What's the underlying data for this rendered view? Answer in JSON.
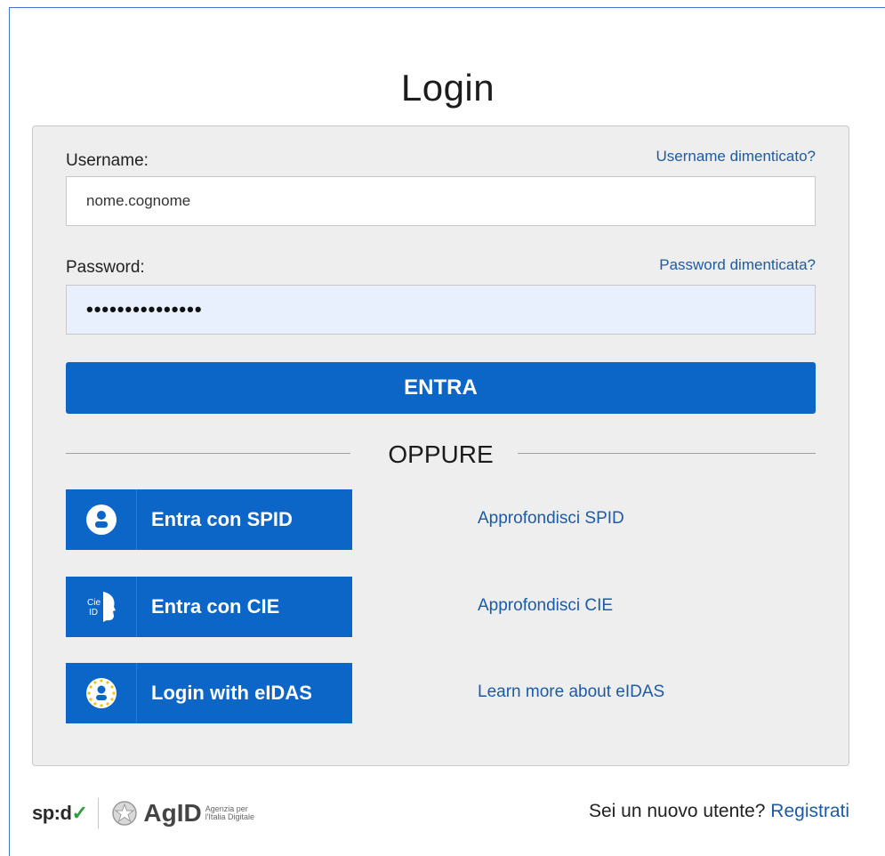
{
  "page": {
    "title": "Login"
  },
  "form": {
    "username_label": "Username:",
    "username_forgot": "Username dimenticato?",
    "username_value": "nome.cognome",
    "password_label": "Password:",
    "password_forgot": "Password dimenticata?",
    "password_value": "•••••••••••••••",
    "submit_label": "ENTRA",
    "separator": "OPPURE"
  },
  "alt_logins": [
    {
      "label": "Entra con SPID",
      "icon": "spid-user-icon",
      "more": "Approfondisci SPID"
    },
    {
      "label": "Entra con CIE",
      "icon": "cie-id-icon",
      "more": "Approfondisci CIE"
    },
    {
      "label": "Login with eIDAS",
      "icon": "eidas-user-icon",
      "more": "Learn more about eIDAS"
    }
  ],
  "footer": {
    "spid_logo_text": "sp:d",
    "agid_logo_text": "AgID",
    "agid_subtitle_1": "Agenzia per",
    "agid_subtitle_2": "l'Italia Digitale",
    "new_user_text": "Sei un nuovo utente?",
    "register_link": "Registrati"
  },
  "colors": {
    "primary": "#0b66c8",
    "link": "#1d5ba6",
    "card_bg": "#eeeeee"
  }
}
